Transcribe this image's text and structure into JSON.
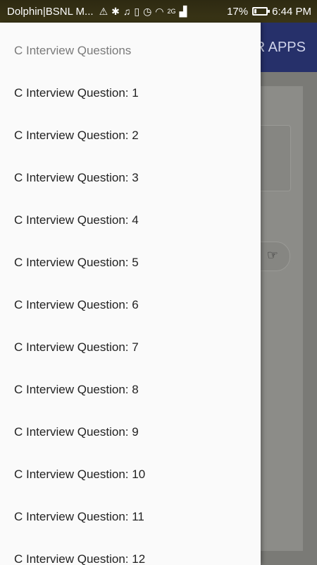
{
  "status_bar": {
    "carrier": "Dolphin|BSNL M...",
    "network": "2G",
    "battery": "17%",
    "battery_level": 0.17,
    "time": "6:44 PM"
  },
  "background_app": {
    "toolbar_title": "R APPS"
  },
  "drawer": {
    "header": "C Interview Questions",
    "items": [
      "C Interview Question: 1",
      "C Interview Question: 2",
      "C Interview Question: 3",
      "C Interview Question: 4",
      "C Interview Question: 5",
      "C Interview Question: 6",
      "C Interview Question: 7",
      "C Interview Question: 8",
      "C Interview Question: 9",
      "C Interview Question: 10",
      "C Interview Question: 11",
      "C Interview Question: 12"
    ]
  }
}
